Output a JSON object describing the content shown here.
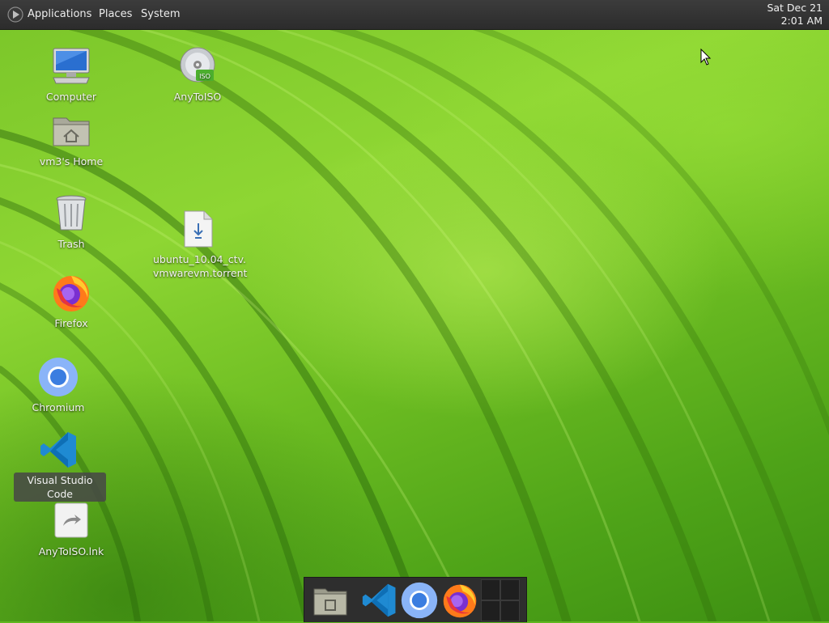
{
  "top_panel": {
    "menus": [
      "Applications",
      "Places",
      "System"
    ],
    "clock": {
      "date": "Sat Dec 21",
      "time": "2:01 AM"
    }
  },
  "desktop_icons": {
    "computer": "Computer",
    "anytoiso": "AnyToISO",
    "anytoiso_badge": "ISO",
    "home": "vm3's Home",
    "trash": "Trash",
    "torrent_line1": "ubuntu_10.04_ctv.",
    "torrent_line2": "vmwarevm.torrent",
    "firefox": "Firefox",
    "chromium": "Chromium",
    "vscode": "Visual Studio Code",
    "anytoiso_lnk": "AnyToISO.lnk"
  },
  "dock": {
    "items": [
      "file-manager",
      "visual-studio-code",
      "chromium",
      "firefox"
    ],
    "workspace_count": 4
  },
  "colors": {
    "panel": "#2c2c2c",
    "wallpaper_green": "#6dbd22",
    "chromium_blue": "#3b7de0",
    "vscode_blue": "#1f8ad2"
  }
}
